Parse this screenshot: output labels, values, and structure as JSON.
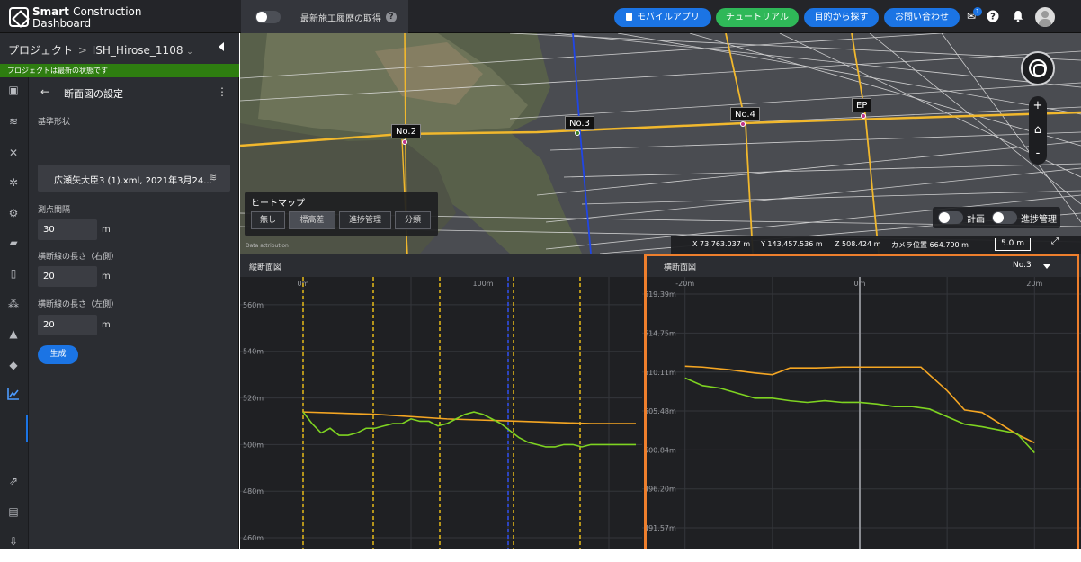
{
  "header": {
    "logo_line1_bold": "Smart",
    "logo_line1_rest": "Construction",
    "logo_line2": "Dashboard",
    "history_label": "最新施工履歴の取得",
    "history_help": "?",
    "btn_mobile": "モバイルアプリ",
    "btn_tutorial": "チュートリアル",
    "btn_search": "目的から探す",
    "btn_contact": "お問い合わせ",
    "notification_count": "1",
    "accent_blue": "#1b74e4",
    "accent_green": "#2fb858"
  },
  "project": {
    "breadcrumb_root": "プロジェクト",
    "breadcrumb_sep": ">",
    "project_name": "ISH_Hirose_1108",
    "status": "プロジェクトは最新の状態です",
    "status_color": "#2e7d10"
  },
  "form": {
    "title": "断面図の設定",
    "shape_label": "基準形状",
    "shape_value": "広瀬矢大臣3 (1).xml, 2021年3月24...",
    "interval_label": "測点間隔",
    "interval_value": "30",
    "interval_unit": "m",
    "right_label": "横断線の長さ（右側）",
    "right_value": "20",
    "right_unit": "m",
    "left_label": "横断線の長さ（左側）",
    "left_value": "20",
    "left_unit": "m",
    "generate": "生成"
  },
  "view3d": {
    "markers": [
      "No.2",
      "No.3",
      "No.4",
      "EP"
    ],
    "heatmap_title": "ヒートマップ",
    "heatmap_options": [
      "無し",
      "標高差",
      "進捗管理",
      "分類"
    ],
    "heatmap_selected": "標高差",
    "toggle_plan": "計画",
    "toggle_progress": "進捗管理",
    "coord_x": "X 73,763.037 m",
    "coord_y": "Y 143,457.536 m",
    "coord_z": "Z 508.424 m",
    "camera": "カメラ位置 664.790 m",
    "scale": "5.0 m",
    "attribution": "Data attribution",
    "zoom_in": "+",
    "zoom_out": "-"
  },
  "long_profile": {
    "title": "縦断面図",
    "x_ticks": [
      "0m",
      "100m"
    ],
    "y_ticks": [
      "560m",
      "540m",
      "520m",
      "500m",
      "480m",
      "460m"
    ]
  },
  "cross_profile": {
    "title": "横断面図",
    "station": "No.3",
    "x_ticks": [
      "-20m",
      "0m",
      "20m"
    ],
    "y_ticks": [
      "519.39m",
      "514.75m",
      "510.11m",
      "505.48m",
      "500.84m",
      "496.20m",
      "491.57m"
    ]
  },
  "chart_data": [
    {
      "type": "line",
      "title": "縦断面図",
      "x_unit": "m",
      "ylim": [
        455,
        570
      ],
      "xlim": [
        0,
        185
      ],
      "y_ticks": [
        560,
        540,
        520,
        500,
        480,
        460
      ],
      "station_lines_x": [
        0,
        39,
        76,
        117,
        154
      ],
      "current_station_x": 114,
      "series": [
        {
          "color": "#f5a623",
          "x": [
            0,
            40,
            80,
            120,
            160,
            185
          ],
          "y": [
            514,
            513,
            511,
            510,
            509,
            509
          ]
        },
        {
          "color": "#7ed321",
          "x": [
            0,
            5,
            10,
            15,
            20,
            25,
            30,
            35,
            40,
            45,
            50,
            55,
            60,
            65,
            70,
            75,
            80,
            85,
            90,
            95,
            100,
            105,
            110,
            115,
            120,
            125,
            130,
            135,
            140,
            145,
            150,
            155,
            160,
            165,
            170,
            175,
            180,
            185
          ],
          "y": [
            514,
            509,
            505,
            507,
            504,
            504,
            505,
            507,
            507,
            508,
            509,
            509,
            511,
            510,
            510,
            508,
            509,
            511,
            513,
            514,
            513,
            511,
            509,
            506,
            503,
            501,
            500,
            499,
            499,
            500,
            500,
            499,
            500,
            500,
            500,
            500,
            500,
            500
          ]
        }
      ]
    },
    {
      "type": "line",
      "title": "横断面図",
      "x_unit": "m",
      "xlim": [
        -21,
        21
      ],
      "ylim": [
        489,
        521
      ],
      "y_ticks": [
        519.39,
        514.75,
        510.11,
        505.48,
        500.84,
        496.2,
        491.57
      ],
      "series": [
        {
          "color": "#f5a623",
          "x": [
            -20,
            -18,
            -15,
            -12,
            -10,
            -8,
            -5,
            -2,
            0,
            2,
            5,
            7,
            10,
            12,
            14,
            16,
            18,
            20
          ],
          "y": [
            510.8,
            510.7,
            510.4,
            510.0,
            509.8,
            510.6,
            510.6,
            510.7,
            510.7,
            510.7,
            510.7,
            510.7,
            507.9,
            505.6,
            505.3,
            504.0,
            502.7,
            501.7
          ]
        },
        {
          "color": "#7ed321",
          "x": [
            -20,
            -18,
            -16,
            -14,
            -12,
            -10,
            -8,
            -6,
            -4,
            -2,
            0,
            2,
            4,
            6,
            8,
            10,
            12,
            14,
            16,
            18,
            20
          ],
          "y": [
            509.4,
            508.5,
            508.2,
            507.6,
            507.0,
            507.0,
            506.7,
            506.5,
            506.7,
            506.5,
            506.5,
            506.3,
            506.0,
            506.0,
            505.7,
            504.8,
            503.9,
            503.6,
            503.2,
            502.8,
            500.5
          ]
        }
      ]
    }
  ]
}
